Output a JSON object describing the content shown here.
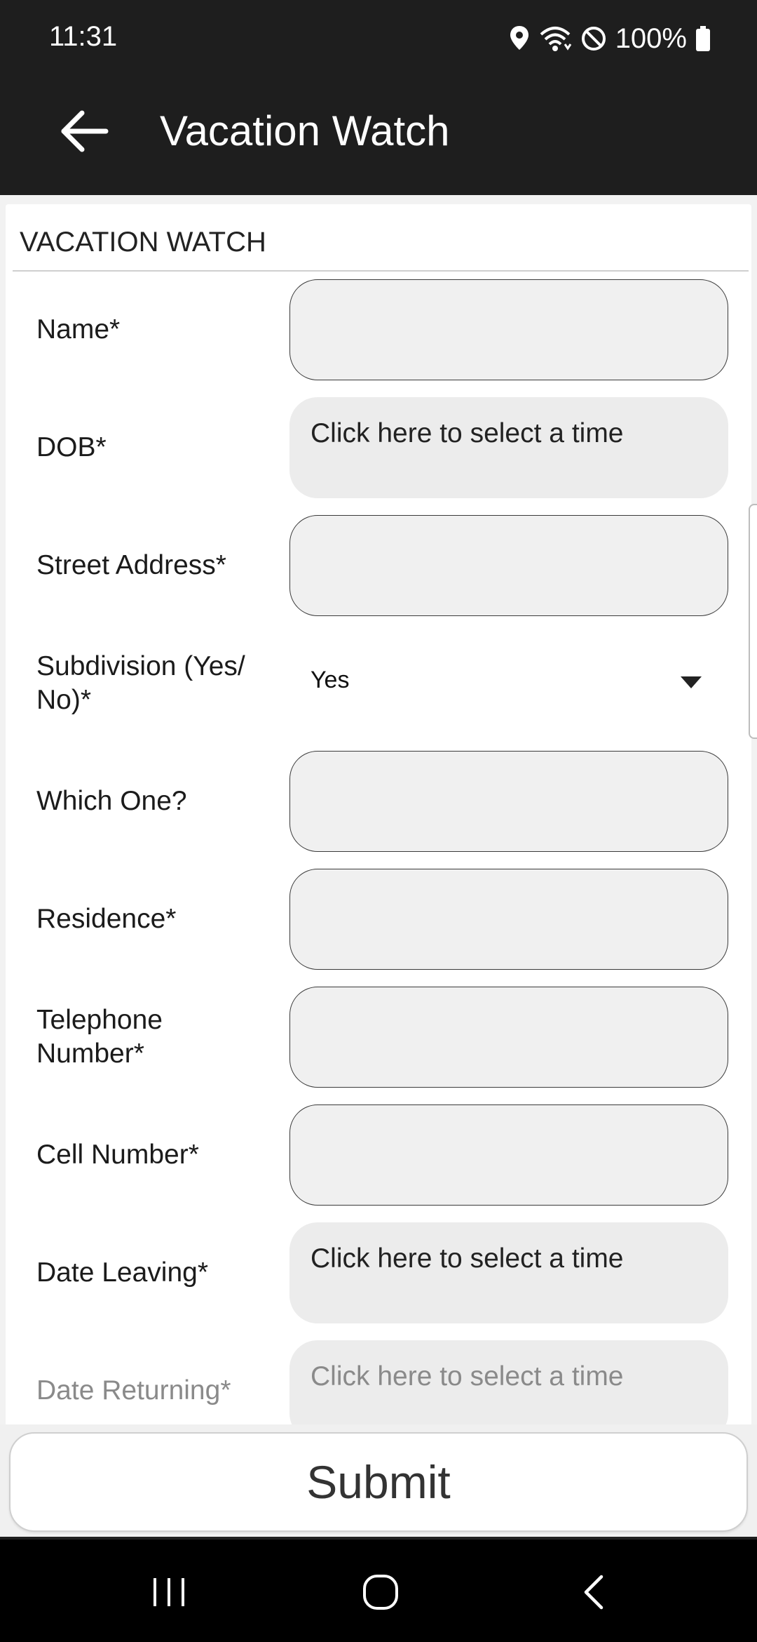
{
  "status_bar": {
    "time": "11:31",
    "battery": "100%",
    "icons": [
      "location-icon",
      "wifi-icon",
      "do-not-disturb-icon",
      "battery-icon"
    ]
  },
  "app_bar": {
    "title": "Vacation Watch",
    "back_icon": "arrow-left-icon"
  },
  "form": {
    "section_title": "VACATION WATCH",
    "fields": [
      {
        "label": "Name*",
        "kind": "text",
        "value": ""
      },
      {
        "label": "DOB*",
        "kind": "time",
        "value": "Click here to select a time"
      },
      {
        "label": "Street Address*",
        "kind": "text",
        "value": ""
      },
      {
        "label": "Subdivision (Yes/\nNo)*",
        "kind": "select",
        "value": "Yes"
      },
      {
        "label": "Which One?",
        "kind": "text",
        "value": ""
      },
      {
        "label": "Residence*",
        "kind": "text",
        "value": ""
      },
      {
        "label": "Telephone\nNumber*",
        "kind": "text",
        "value": ""
      },
      {
        "label": "Cell Number*",
        "kind": "text",
        "value": ""
      },
      {
        "label": "Date Leaving*",
        "kind": "time",
        "value": "Click here to select a time"
      },
      {
        "label": "Date Returning*",
        "kind": "time",
        "value": "Click here to select a time"
      }
    ]
  },
  "submit": {
    "label": "Submit"
  },
  "nav_bar": {
    "items": [
      "recent-apps-icon",
      "home-icon",
      "back-icon"
    ]
  },
  "colors": {
    "app_bar": "#1e1e1e",
    "field_bg": "#f0f0f0",
    "field_border": "#3a3a3a"
  }
}
